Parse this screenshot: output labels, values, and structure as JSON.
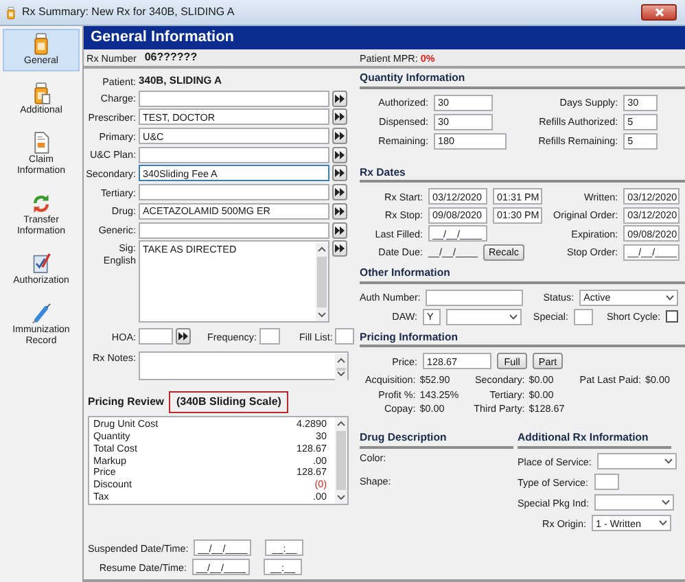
{
  "window": {
    "title": "Rx Summary: New Rx for 340B, SLIDING A"
  },
  "sidebar": {
    "items": [
      {
        "label": "General",
        "selected": true
      },
      {
        "label": "Additional",
        "selected": false
      },
      {
        "label": "Claim Information",
        "selected": false
      },
      {
        "label": "Transfer Information",
        "selected": false
      },
      {
        "label": "Authorization",
        "selected": false
      },
      {
        "label": "Immunization Record",
        "selected": false
      }
    ]
  },
  "header": {
    "title": "General Information"
  },
  "rx_number": {
    "label": "Rx Number",
    "value": "06??????"
  },
  "patient_mpr": {
    "label": "Patient MPR:",
    "value": "0%"
  },
  "patient": {
    "label": "Patient:",
    "value": "340B, SLIDING A"
  },
  "lookup_fields": [
    {
      "label": "Charge:",
      "focused": false
    },
    {
      "label": "Prescriber:",
      "value": "TEST, DOCTOR",
      "focused": false
    },
    {
      "label": "Primary:",
      "value": "U&C",
      "focused": false
    },
    {
      "label": "U&C Plan:",
      "focused": false
    },
    {
      "label": "Secondary:",
      "value": "340Sliding Fee A",
      "focused": true
    },
    {
      "label": "Tertiary:",
      "focused": false
    },
    {
      "label": "Drug:",
      "value": "ACETAZOLAMID 500MG ER",
      "focused": false
    },
    {
      "label": "Generic:",
      "focused": false
    }
  ],
  "sig": {
    "label": "Sig:",
    "sublabel": "English",
    "value": "TAKE AS DIRECTED"
  },
  "hoa": {
    "label": "HOA:"
  },
  "frequency": {
    "label": "Frequency:"
  },
  "fill_list": {
    "label": "Fill List:"
  },
  "rx_notes": {
    "label": "Rx Notes:"
  },
  "pricing_review": {
    "title": "Pricing Review",
    "scale": "(340B Sliding Scale)",
    "rows": [
      {
        "name": "Drug Unit Cost",
        "value": "4.2890",
        "kind": "normal"
      },
      {
        "name": "Quantity",
        "value": "30",
        "kind": "normal"
      },
      {
        "name": "Total Cost",
        "value": "128.67",
        "kind": "normal"
      },
      {
        "name": "Markup",
        "value": ".00",
        "kind": "normal"
      },
      {
        "name": "Price",
        "value": "128.67",
        "kind": "normal"
      },
      {
        "name": "Discount",
        "value": "(0)",
        "kind": "negative"
      },
      {
        "name": "Tax",
        "value": ".00",
        "kind": "normal"
      }
    ]
  },
  "suspend": [
    {
      "label": "Suspended Date/Time:",
      "date": "__/__/____",
      "time": "__:__"
    },
    {
      "label": "Resume Date/Time:",
      "date": "__/__/____",
      "time": "__:__"
    }
  ],
  "quantity": {
    "title": "Quantity Information",
    "left": [
      {
        "label": "Authorized:",
        "value": "30"
      },
      {
        "label": "Dispensed:",
        "value": "30"
      },
      {
        "label": "Remaining:",
        "value": "180"
      }
    ],
    "right": [
      {
        "label": "Days Supply:",
        "value": "30"
      },
      {
        "label": "Refills Authorized:",
        "value": "5"
      },
      {
        "label": "Refills Remaining:",
        "value": "5"
      }
    ]
  },
  "rx_dates": {
    "title": "Rx Dates",
    "left": [
      {
        "label": "Rx Start:",
        "kind": "datetime",
        "value": "03/12/2020",
        "time": "01:31 PM"
      },
      {
        "label": "Rx Stop:",
        "kind": "datetime",
        "value": "09/08/2020",
        "time": "01:30 PM"
      },
      {
        "label": "Last Filled:",
        "kind": "date",
        "value": "__/__/____"
      },
      {
        "label": "Date Due:",
        "kind": "text",
        "value": "__/__/____",
        "button": "Recalc"
      }
    ],
    "right": [
      {
        "label": "Written:",
        "value": "03/12/2020"
      },
      {
        "label": "Original Order:",
        "value": "03/12/2020"
      },
      {
        "label": "Expiration:",
        "value": "09/08/2020"
      },
      {
        "label": "Stop Order:",
        "value": "__/__/____"
      }
    ]
  },
  "other_information": {
    "title": "Other Information",
    "auth_number": {
      "label": "Auth Number:"
    },
    "status": {
      "label": "Status:",
      "value": "Active"
    },
    "daw": {
      "label": "DAW:",
      "code": "Y"
    },
    "special": {
      "label": "Special:"
    },
    "short_cycle": {
      "label": "Short Cycle:",
      "checked": false
    }
  },
  "pricing_information": {
    "title": "Pricing Information",
    "price": {
      "label": "Price:",
      "value": "128.67"
    },
    "buttons": [
      "Full",
      "Part"
    ],
    "columns": [
      [
        {
          "label": "Acquisition:",
          "value": "$52.90"
        },
        {
          "label": "Profit %:",
          "value": "143.25%"
        },
        {
          "label": "Copay:",
          "value": "$0.00"
        }
      ],
      [
        {
          "label": "Secondary:",
          "value": "$0.00"
        },
        {
          "label": "Tertiary:",
          "value": "$0.00"
        },
        {
          "label": "Third Party:",
          "value": "$128.67"
        }
      ],
      [
        {
          "label": "Pat Last Paid:",
          "value": "$0.00"
        }
      ]
    ]
  },
  "drug_description": {
    "title": "Drug Description",
    "fields": [
      "Color:",
      "Shape:"
    ]
  },
  "additional_rx": {
    "title": "Additional Rx Information",
    "fields": [
      {
        "label": "Place of Service:",
        "kind": "dropdown"
      },
      {
        "label": "Type of Service:",
        "kind": "text"
      },
      {
        "label": "Special Pkg Ind:",
        "kind": "dropdown"
      },
      {
        "label": "Rx Origin:",
        "kind": "dropdown",
        "value": "1 - Written"
      }
    ]
  }
}
